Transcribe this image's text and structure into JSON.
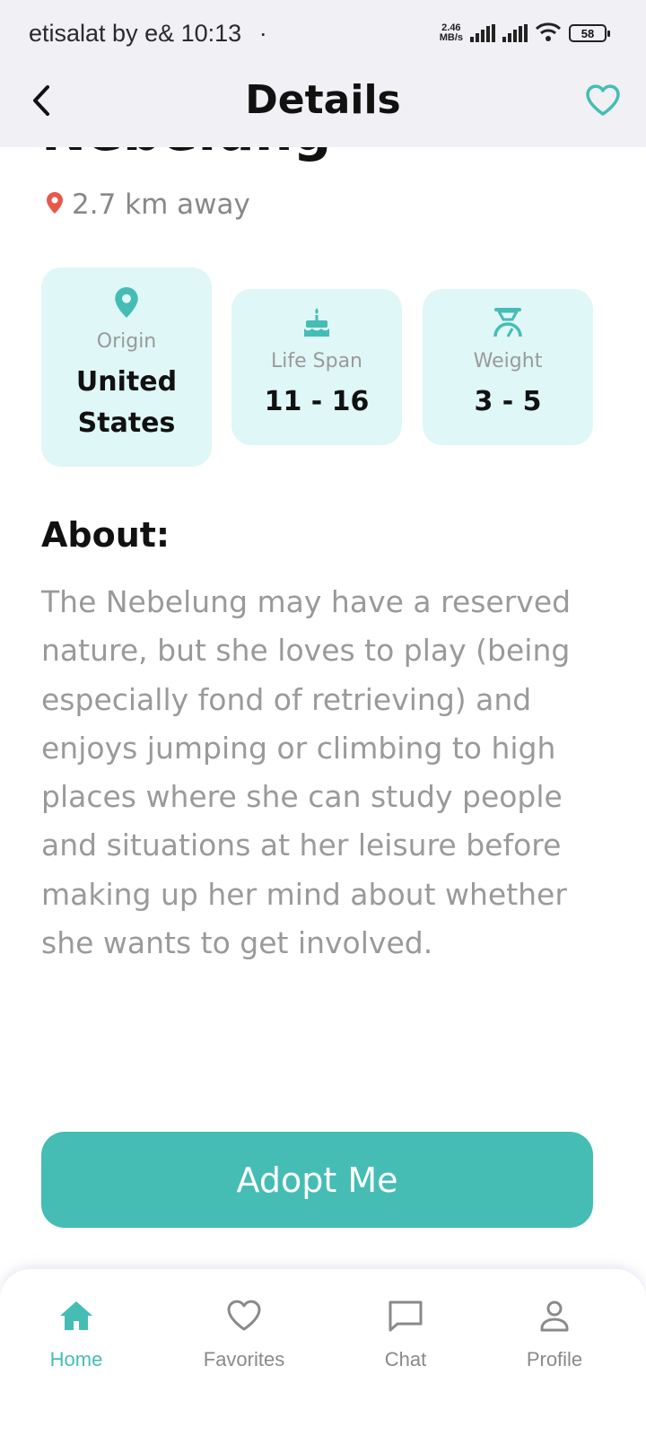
{
  "status_bar": {
    "carrier": "etisalat by e&",
    "time": "10:13",
    "dot": "·",
    "net_speed_value": "2.46",
    "net_speed_unit": "MB/s",
    "battery": "58"
  },
  "header": {
    "title": "Details",
    "back_icon": "chevron-left-icon",
    "favorite_icon": "heart-outline-icon"
  },
  "pet": {
    "name": "Nebelung",
    "distance": "2.7 km away"
  },
  "info_cards": {
    "origin": {
      "label": "Origin",
      "value_line1": "United",
      "value_line2": "States"
    },
    "life_span": {
      "label": "Life Span",
      "value": "11 - 16"
    },
    "weight": {
      "label": "Weight",
      "value": "3 - 5"
    }
  },
  "about": {
    "title": "About:",
    "text": "The Nebelung may have a reserved nature, but she loves to play (being especially fond of retrieving) and enjoys jumping or climbing to high places where she can study people and situations at her leisure before making up her mind about whether she wants to get involved."
  },
  "adopt_button": {
    "label": "Adopt Me"
  },
  "nav": {
    "items": [
      {
        "label": "Home",
        "icon": "home-icon",
        "active": true
      },
      {
        "label": "Favorites",
        "icon": "heart-icon",
        "active": false
      },
      {
        "label": "Chat",
        "icon": "chat-icon",
        "active": false
      },
      {
        "label": "Profile",
        "icon": "person-icon",
        "active": false
      }
    ]
  },
  "colors": {
    "accent": "#45bdb5",
    "card_bg": "#dff7f6",
    "header_bg": "#f0f0f5",
    "location_pin": "#e8584a"
  }
}
